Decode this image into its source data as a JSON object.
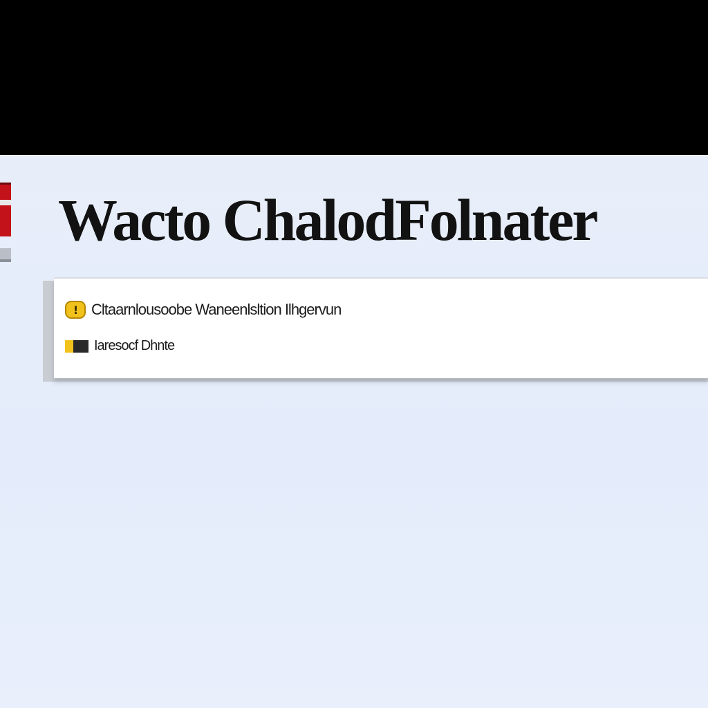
{
  "header": {
    "title": "Wacto ChalodFolnater"
  },
  "results": {
    "items": [
      {
        "icon": "warning-icon",
        "label": "Cltaarnlousoobe Waneenlsltion Ilhgervun"
      },
      {
        "icon": "folder-icon",
        "label": "Iaresocf Dhnte"
      }
    ]
  },
  "colors": {
    "top_bar": "#000000",
    "background": "#e6edfa",
    "brand_red": "#c4121a",
    "warning": "#f1c21b"
  }
}
